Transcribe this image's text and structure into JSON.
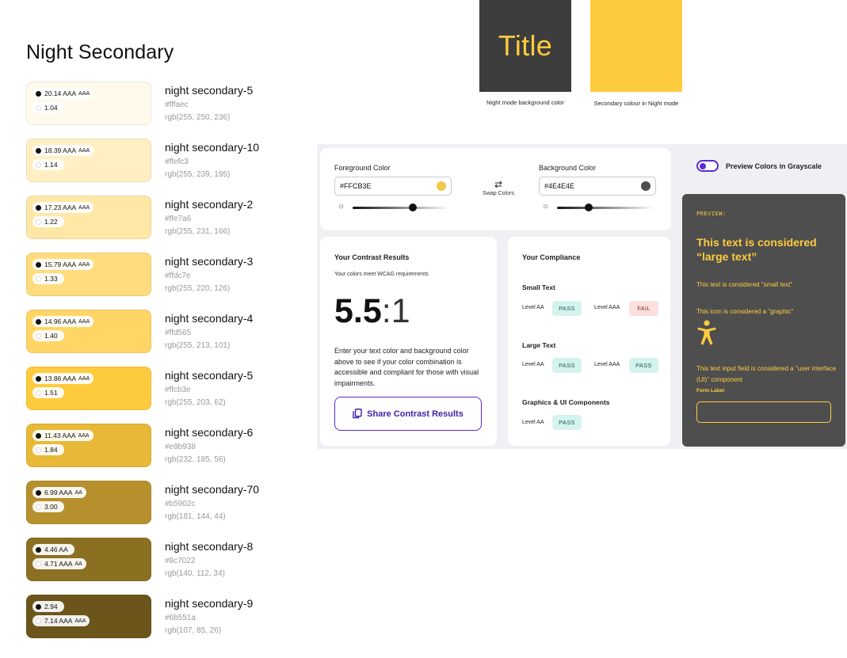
{
  "palette": {
    "title": "Night Secondary",
    "swatches": [
      {
        "name": "night secondary-5",
        "hex": "#fffaec",
        "rgb": "rgb(255, 250, 236)",
        "color": "#fffaec",
        "black_text": "20.14 AAA",
        "black_rating": "AAA",
        "white_text": "1.04",
        "white_rating": ""
      },
      {
        "name": "night secondary-10",
        "hex": "#ffefc3",
        "rgb": "rgb(255, 239, 195)",
        "color": "#ffefc3",
        "black_text": "18.39 AAA",
        "black_rating": "AAA",
        "white_text": "1.14",
        "white_rating": ""
      },
      {
        "name": "night secondary-2",
        "hex": "#ffe7a6",
        "rgb": "rgb(255, 231, 166)",
        "color": "#ffe7a6",
        "black_text": "17.23 AAA",
        "black_rating": "AAA",
        "white_text": "1.22",
        "white_rating": ""
      },
      {
        "name": "night secondary-3",
        "hex": "#ffdc7e",
        "rgb": "rgb(255, 220, 126)",
        "color": "#ffdc7e",
        "black_text": "15.79 AAA",
        "black_rating": "AAA",
        "white_text": "1.33",
        "white_rating": ""
      },
      {
        "name": "night secondary-4",
        "hex": "#ffd565",
        "rgb": "rgb(255, 213, 101)",
        "color": "#ffd565",
        "black_text": "14.96 AAA",
        "black_rating": "AAA",
        "white_text": "1.40",
        "white_rating": ""
      },
      {
        "name": "night secondary-5",
        "hex": "#ffcb3e",
        "rgb": "rgb(255, 203, 62)",
        "color": "#ffcb3e",
        "black_text": "13.86 AAA",
        "black_rating": "AAA",
        "white_text": "1.51",
        "white_rating": ""
      },
      {
        "name": "night secondary-6",
        "hex": "#e8b938",
        "rgb": "rgb(232, 185, 56)",
        "color": "#e8b938",
        "black_text": "11.43 AAA",
        "black_rating": "AAA",
        "white_text": "1.84",
        "white_rating": ""
      },
      {
        "name": "night secondary-70",
        "hex": "#b5902c",
        "rgb": "rgb(181, 144, 44)",
        "color": "#b5902c",
        "black_text": "6.99 AAA",
        "black_rating": "AA",
        "white_text": "3.00",
        "white_rating": ""
      },
      {
        "name": "night secondary-8",
        "hex": "#8c7022",
        "rgb": "rgb(140, 112, 34)",
        "color": "#8c7022",
        "black_text": "4.46 AA",
        "black_rating": "",
        "white_text": "4.71 AAA",
        "white_rating": "AA"
      },
      {
        "name": "night secondary-9",
        "hex": "#6b551a",
        "rgb": "rgb(107, 85, 26)",
        "color": "#6b551a",
        "black_text": "2.94",
        "black_rating": "",
        "white_text": "7.14 AAA",
        "white_rating": "AAA"
      }
    ]
  },
  "title_card": {
    "text": "Title",
    "caption": "Night mode background color",
    "bg": "#3d3d3d",
    "fg": "#ffcb3e"
  },
  "yellow_card": {
    "caption": "Secondary colour in Night mode",
    "color": "#ffcb3e"
  },
  "checker": {
    "foreground": {
      "label": "Foreground Color",
      "value": "#FFCB3E",
      "color": "#f5c84a"
    },
    "background": {
      "label": "Background Color",
      "value": "#4E4E4E",
      "color": "#4e4e4e"
    },
    "swap_label": "Swap Colors",
    "swap_icon": "swap-arrows-icon",
    "slider_icon": "sun-icon",
    "fg_slider_level": 0.62,
    "bg_slider_level": 0.33,
    "results": {
      "heading": "Your Contrast Results",
      "subtitle": "Your colors meet WCAG requirements",
      "ratio_main": "5.5",
      "ratio_suffix": ":1",
      "body": "Enter your text color and background color above to see if your color combination is accessible and compliant for those with visual impairments.",
      "share_label": "Share Contrast Results",
      "share_icon": "copy-icon"
    },
    "compliance": {
      "heading": "Your Compliance",
      "small_text": {
        "title": "Small Text",
        "aa_label": "Level AA",
        "aa": "PASS",
        "aaa_label": "Level AAA",
        "aaa": "FAIL"
      },
      "large_text": {
        "title": "Large Text",
        "aa_label": "Level AA",
        "aa": "PASS",
        "aaa_label": "Level AAA",
        "aaa": "PASS"
      },
      "graphics": {
        "title": "Graphics & UI Components",
        "aa_label": "Level AA",
        "aa": "PASS"
      }
    },
    "grayscale_label": "Preview Colors in Grayscale",
    "grayscale_enabled": true,
    "accent": "#5a2bd6",
    "preview": {
      "label": "PREVIEW:",
      "large_text": "This text is considered “large text”",
      "small_text": "This text is considered \"small text\"",
      "icon_text": "This icon is considered a \"graphic\"",
      "icon": "accessibility-person-icon",
      "input_text": "This text input field is considered a \"user interface (UI)\" component",
      "form_label": "Form Label"
    }
  }
}
